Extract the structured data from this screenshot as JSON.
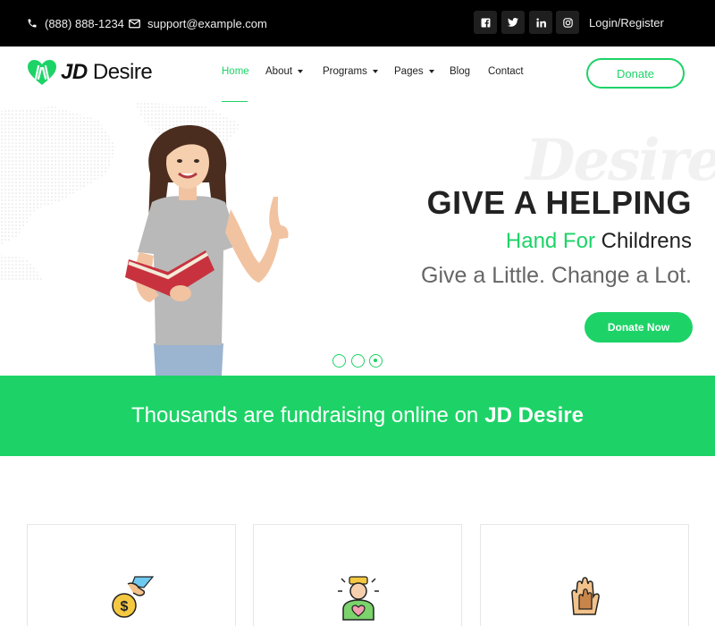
{
  "topbar": {
    "phone": "(888) 888-1234",
    "email": "support@example.com",
    "social": [
      {
        "name": "facebook-icon",
        "glyph": "f"
      },
      {
        "name": "twitter-icon",
        "glyph": "t"
      },
      {
        "name": "linkedin-icon",
        "glyph": "in"
      },
      {
        "name": "instagram-icon",
        "glyph": "ig"
      }
    ],
    "login_label": "Login/Register"
  },
  "header": {
    "logo_bold": "JD",
    "logo_rest": "Desire",
    "nav": [
      {
        "label": "Home",
        "active": true,
        "dropdown": false
      },
      {
        "label": "About",
        "active": false,
        "dropdown": true
      },
      {
        "label": "Programs",
        "active": false,
        "dropdown": true
      },
      {
        "label": "Pages",
        "active": false,
        "dropdown": true
      },
      {
        "label": "Blog",
        "active": false,
        "dropdown": false
      },
      {
        "label": "Contact",
        "active": false,
        "dropdown": false
      }
    ],
    "donate_label": "Donate"
  },
  "hero": {
    "watermark": "Desire",
    "headline": "GIVE A HELPING",
    "subline_green": "Hand For",
    "subline_rest": "Childrens",
    "tagline": "Give a Little. Change a Lot.",
    "cta_label": "Donate Now",
    "slides": 3,
    "active_slide": 3
  },
  "banner": {
    "text": "Thousands are fundraising online on",
    "brand": "JD Desire"
  },
  "cards": [
    {
      "icon": "coin-hand-icon"
    },
    {
      "icon": "person-heart-icon"
    },
    {
      "icon": "helping-hands-icon"
    }
  ],
  "colors": {
    "accent": "#1dd367",
    "topbar_bg": "#000000",
    "text_dark": "#222222"
  }
}
